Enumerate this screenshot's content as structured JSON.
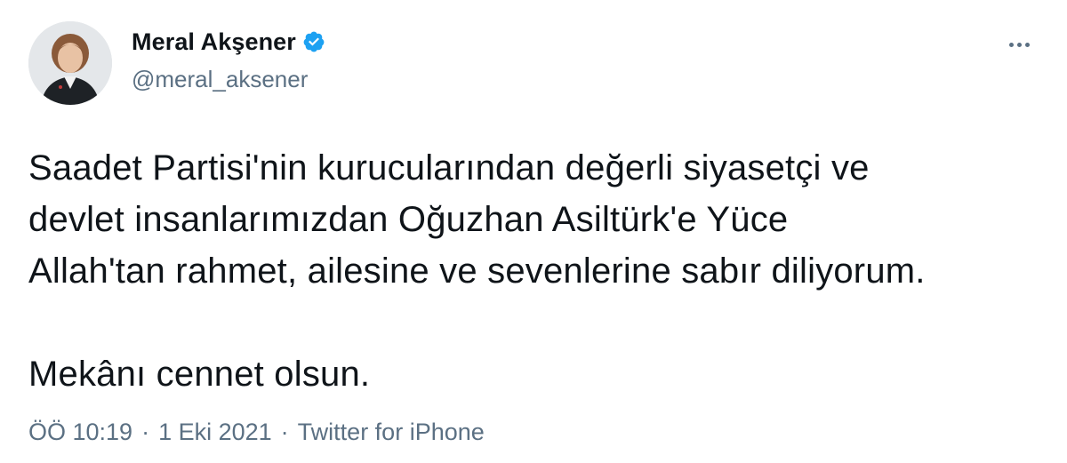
{
  "author": {
    "display_name": "Meral Akşener",
    "handle": "@meral_aksener",
    "verified": true
  },
  "tweet": {
    "lines": [
      "Saadet Partisi'nin kurucularından değerli siyasetçi ve",
      "devlet insanlarımızdan Oğuzhan Asiltürk'e Yüce",
      "Allah'tan rahmet, ailesine ve sevenlerine sabır diliyorum."
    ],
    "closing": "Mekânı cennet olsun."
  },
  "meta": {
    "time": "ÖÖ 10:19",
    "date": "1 Eki 2021",
    "separator": "·",
    "source": "Twitter for iPhone"
  },
  "colors": {
    "verified": "#1da1f2",
    "secondary_text": "#5b7083",
    "primary_text": "#0f1419"
  },
  "icons": {
    "verified": "verified-badge-icon",
    "more": "more-options-icon"
  }
}
